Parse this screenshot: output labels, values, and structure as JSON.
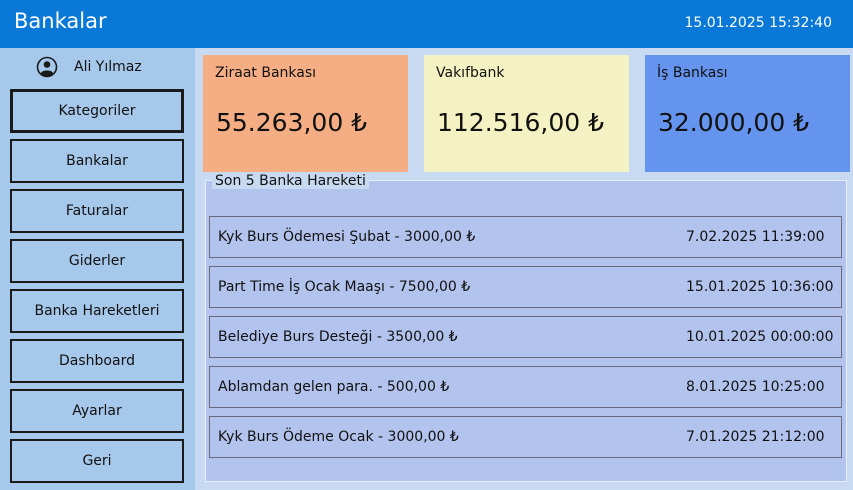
{
  "header": {
    "title": "Bankalar",
    "datetime": "15.01.2025 15:32:40"
  },
  "sidebar": {
    "user_name": "Ali Yılmaz",
    "items": [
      {
        "label": "Kategoriler"
      },
      {
        "label": "Bankalar"
      },
      {
        "label": "Faturalar"
      },
      {
        "label": "Giderler"
      },
      {
        "label": "Banka Hareketleri"
      },
      {
        "label": "Dashboard"
      },
      {
        "label": "Ayarlar"
      },
      {
        "label": "Geri"
      }
    ]
  },
  "banks": [
    {
      "name": "Ziraat Bankası",
      "balance": "55.263,00 ₺",
      "color": "#f5ae84"
    },
    {
      "name": "Vakıfbank",
      "balance": "112.516,00 ₺",
      "color": "#f4f2c2"
    },
    {
      "name": "İş Bankası",
      "balance": "32.000,00 ₺",
      "color": "#6594ee"
    }
  ],
  "transactions": {
    "title": "Son 5 Banka Hareketi",
    "items": [
      {
        "description": "Kyk Burs Ödemesi Şubat - 3000,00 ₺",
        "date": "7.02.2025 11:39:00"
      },
      {
        "description": "Part Time İş Ocak Maaşı - 7500,00 ₺",
        "date": "15.01.2025 10:36:00"
      },
      {
        "description": "Belediye Burs Desteği - 3500,00 ₺",
        "date": "10.01.2025 00:00:00"
      },
      {
        "description": "Ablamdan gelen para. - 500,00 ₺",
        "date": "8.01.2025 10:25:00"
      },
      {
        "description": "Kyk Burs Ödeme Ocak - 3000,00 ₺",
        "date": "7.01.2025 21:12:00"
      }
    ]
  }
}
